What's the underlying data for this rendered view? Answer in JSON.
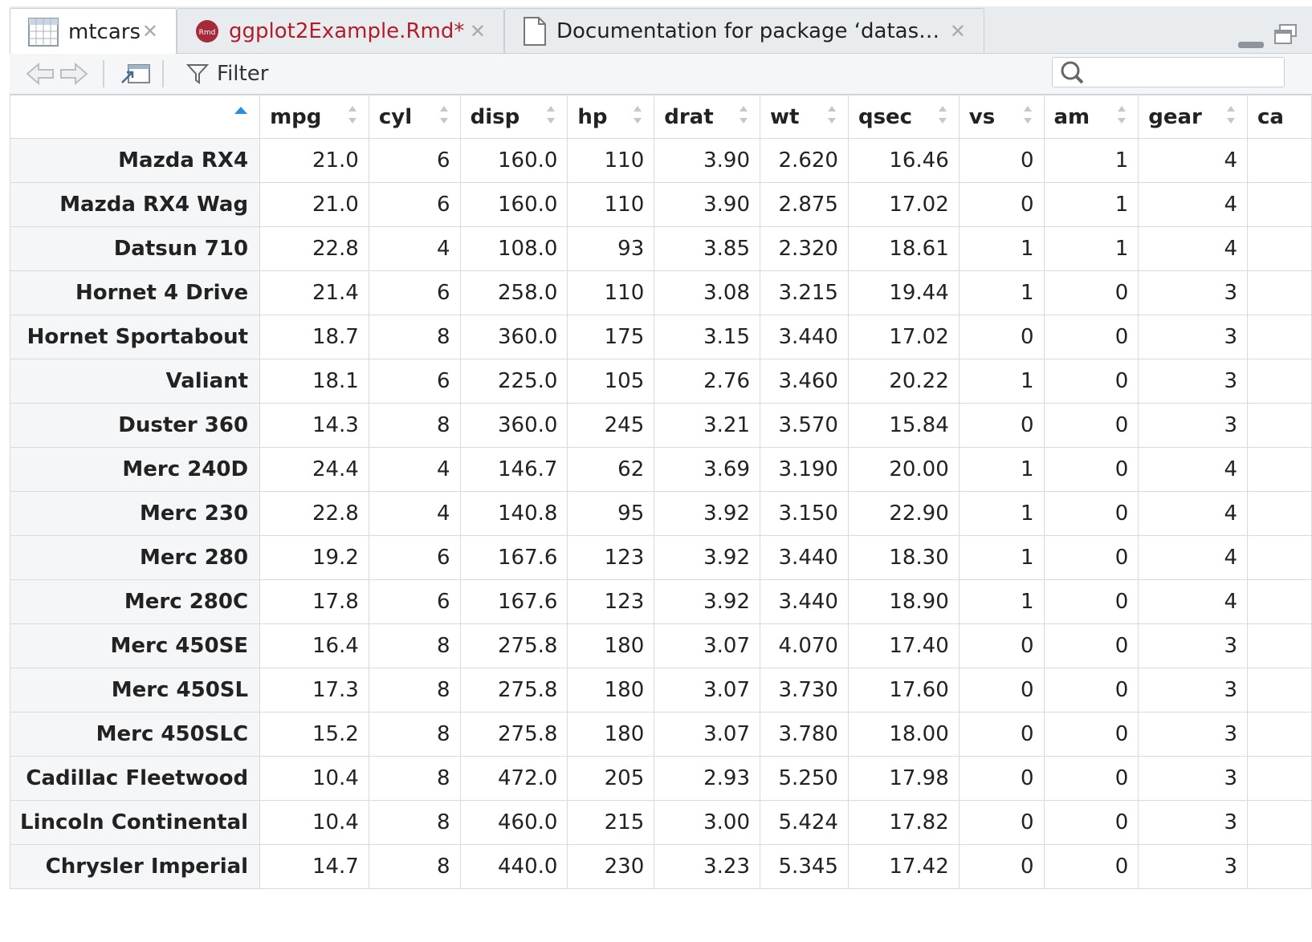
{
  "tabs": [
    {
      "label": "mtcars",
      "icon": "table-icon",
      "active": true
    },
    {
      "label": "ggplot2Example.Rmd*",
      "icon": "rmd-file-icon",
      "active": false
    },
    {
      "label": "Documentation for package ‘datas…",
      "icon": "document-icon",
      "active": false
    }
  ],
  "rmd_badge": "Rmd",
  "toolbar": {
    "filter_label": "Filter",
    "search_placeholder": ""
  },
  "colors": {
    "accent": "#2a8fdc",
    "modified_tab": "#b11d2b",
    "row_header_bg": "#f5f6f7"
  },
  "table": {
    "columns": [
      "",
      "mpg",
      "cyl",
      "disp",
      "hp",
      "drat",
      "wt",
      "qsec",
      "vs",
      "am",
      "gear",
      "ca"
    ],
    "rows": [
      [
        "Mazda RX4",
        "21.0",
        "6",
        "160.0",
        "110",
        "3.90",
        "2.620",
        "16.46",
        "0",
        "1",
        "4",
        ""
      ],
      [
        "Mazda RX4 Wag",
        "21.0",
        "6",
        "160.0",
        "110",
        "3.90",
        "2.875",
        "17.02",
        "0",
        "1",
        "4",
        ""
      ],
      [
        "Datsun 710",
        "22.8",
        "4",
        "108.0",
        "93",
        "3.85",
        "2.320",
        "18.61",
        "1",
        "1",
        "4",
        ""
      ],
      [
        "Hornet 4 Drive",
        "21.4",
        "6",
        "258.0",
        "110",
        "3.08",
        "3.215",
        "19.44",
        "1",
        "0",
        "3",
        ""
      ],
      [
        "Hornet Sportabout",
        "18.7",
        "8",
        "360.0",
        "175",
        "3.15",
        "3.440",
        "17.02",
        "0",
        "0",
        "3",
        ""
      ],
      [
        "Valiant",
        "18.1",
        "6",
        "225.0",
        "105",
        "2.76",
        "3.460",
        "20.22",
        "1",
        "0",
        "3",
        ""
      ],
      [
        "Duster 360",
        "14.3",
        "8",
        "360.0",
        "245",
        "3.21",
        "3.570",
        "15.84",
        "0",
        "0",
        "3",
        ""
      ],
      [
        "Merc 240D",
        "24.4",
        "4",
        "146.7",
        "62",
        "3.69",
        "3.190",
        "20.00",
        "1",
        "0",
        "4",
        ""
      ],
      [
        "Merc 230",
        "22.8",
        "4",
        "140.8",
        "95",
        "3.92",
        "3.150",
        "22.90",
        "1",
        "0",
        "4",
        ""
      ],
      [
        "Merc 280",
        "19.2",
        "6",
        "167.6",
        "123",
        "3.92",
        "3.440",
        "18.30",
        "1",
        "0",
        "4",
        ""
      ],
      [
        "Merc 280C",
        "17.8",
        "6",
        "167.6",
        "123",
        "3.92",
        "3.440",
        "18.90",
        "1",
        "0",
        "4",
        ""
      ],
      [
        "Merc 450SE",
        "16.4",
        "8",
        "275.8",
        "180",
        "3.07",
        "4.070",
        "17.40",
        "0",
        "0",
        "3",
        ""
      ],
      [
        "Merc 450SL",
        "17.3",
        "8",
        "275.8",
        "180",
        "3.07",
        "3.730",
        "17.60",
        "0",
        "0",
        "3",
        ""
      ],
      [
        "Merc 450SLC",
        "15.2",
        "8",
        "275.8",
        "180",
        "3.07",
        "3.780",
        "18.00",
        "0",
        "0",
        "3",
        ""
      ],
      [
        "Cadillac Fleetwood",
        "10.4",
        "8",
        "472.0",
        "205",
        "2.93",
        "5.250",
        "17.98",
        "0",
        "0",
        "3",
        ""
      ],
      [
        "Lincoln Continental",
        "10.4",
        "8",
        "460.0",
        "215",
        "3.00",
        "5.424",
        "17.82",
        "0",
        "0",
        "3",
        ""
      ],
      [
        "Chrysler Imperial",
        "14.7",
        "8",
        "440.0",
        "230",
        "3.23",
        "5.345",
        "17.42",
        "0",
        "0",
        "3",
        ""
      ]
    ]
  }
}
